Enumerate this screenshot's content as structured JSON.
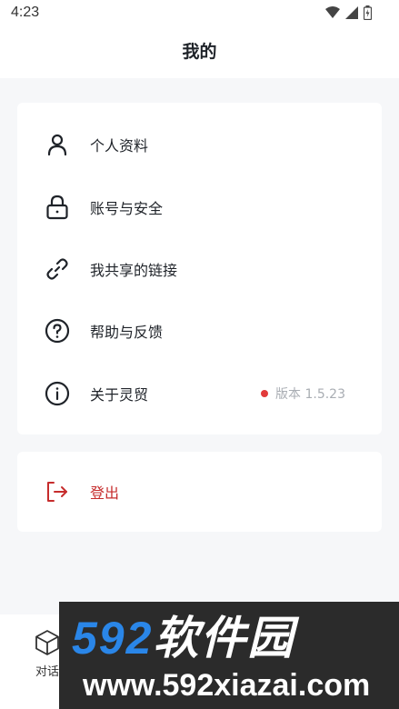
{
  "status_bar": {
    "time": "4:23"
  },
  "header": {
    "title": "我的"
  },
  "menu": {
    "items": [
      {
        "label": "个人资料",
        "icon": "user-icon"
      },
      {
        "label": "账号与安全",
        "icon": "lock-icon"
      },
      {
        "label": "我共享的链接",
        "icon": "link-icon"
      },
      {
        "label": "帮助与反馈",
        "icon": "help-circle-icon"
      },
      {
        "label": "关于灵贸",
        "icon": "info-icon",
        "badge_dot": true,
        "version": "版本 1.5.23"
      }
    ]
  },
  "logout": {
    "label": "登出",
    "icon": "logout-icon"
  },
  "bottom_nav": {
    "items": [
      {
        "label": "对话",
        "icon": "cube-icon"
      }
    ]
  },
  "watermark": {
    "brand_num": "592",
    "brand_cn": "软件园",
    "url": "www.592xiazai.com"
  },
  "colors": {
    "accent_red": "#c62c2c",
    "dot_red": "#e23b3b",
    "watermark_blue": "#2a86e8",
    "watermark_bg": "#2b2b2b"
  }
}
